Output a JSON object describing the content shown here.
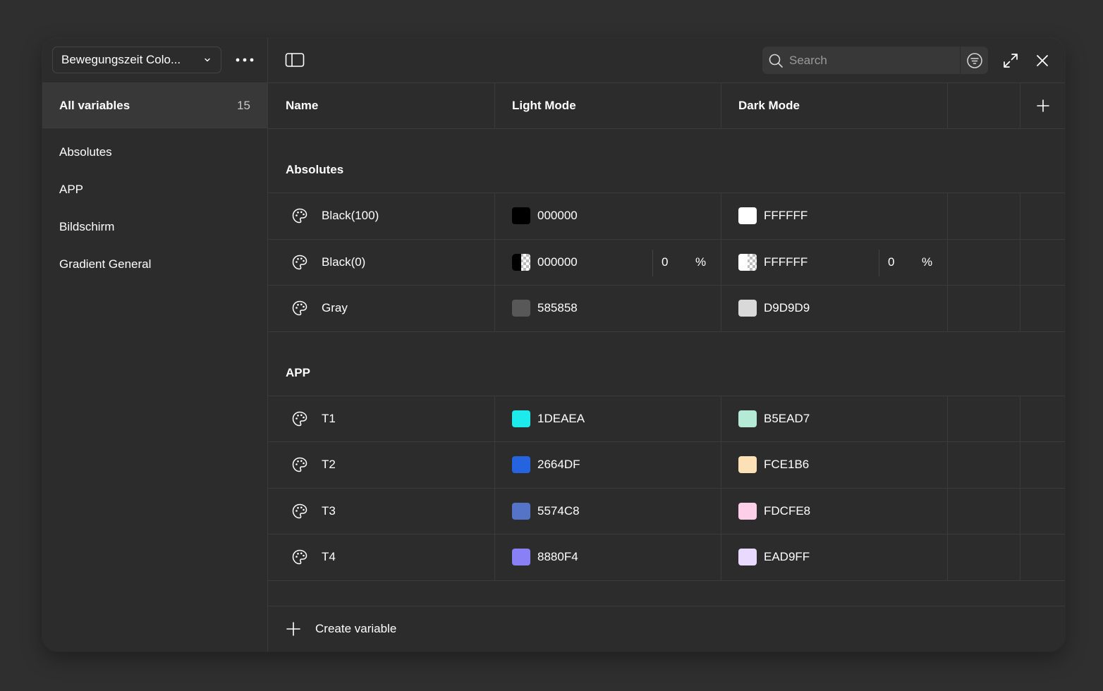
{
  "sidebar": {
    "collection_name": "Bewegungszeit Colo...",
    "all_variables_label": "All variables",
    "all_variables_count": "15",
    "groups": [
      {
        "label": "Absolutes"
      },
      {
        "label": "APP"
      },
      {
        "label": "Bildschirm"
      },
      {
        "label": "Gradient General"
      }
    ]
  },
  "toolbar": {
    "search_placeholder": "Search"
  },
  "table": {
    "columns": [
      "Name",
      "Light Mode",
      "Dark Mode"
    ],
    "groups": [
      {
        "title": "Absolutes",
        "rows": [
          {
            "name": "Black(100)",
            "light": {
              "hex": "000000",
              "color": "#000000"
            },
            "dark": {
              "hex": "FFFFFF",
              "color": "#FFFFFF"
            }
          },
          {
            "name": "Black(0)",
            "light": {
              "hex": "000000",
              "color": "#000000",
              "alpha": "0",
              "pct": "%"
            },
            "dark": {
              "hex": "FFFFFF",
              "color": "#FFFFFF",
              "alpha": "0",
              "pct": "%"
            }
          },
          {
            "name": "Gray",
            "light": {
              "hex": "585858",
              "color": "#585858"
            },
            "dark": {
              "hex": "D9D9D9",
              "color": "#D9D9D9"
            }
          }
        ]
      },
      {
        "title": "APP",
        "rows": [
          {
            "name": "T1",
            "light": {
              "hex": "1DEAEA",
              "color": "#1DEAEA"
            },
            "dark": {
              "hex": "B5EAD7",
              "color": "#B5EAD7"
            }
          },
          {
            "name": "T2",
            "light": {
              "hex": "2664DF",
              "color": "#2664DF"
            },
            "dark": {
              "hex": "FCE1B6",
              "color": "#FCE1B6"
            }
          },
          {
            "name": "T3",
            "light": {
              "hex": "5574C8",
              "color": "#5574C8"
            },
            "dark": {
              "hex": "FDCFE8",
              "color": "#FDCFE8"
            }
          },
          {
            "name": "T4",
            "light": {
              "hex": "8880F4",
              "color": "#8880F4"
            },
            "dark": {
              "hex": "EAD9FF",
              "color": "#EAD9FF"
            }
          }
        ]
      }
    ]
  },
  "footer": {
    "create_label": "Create variable"
  }
}
